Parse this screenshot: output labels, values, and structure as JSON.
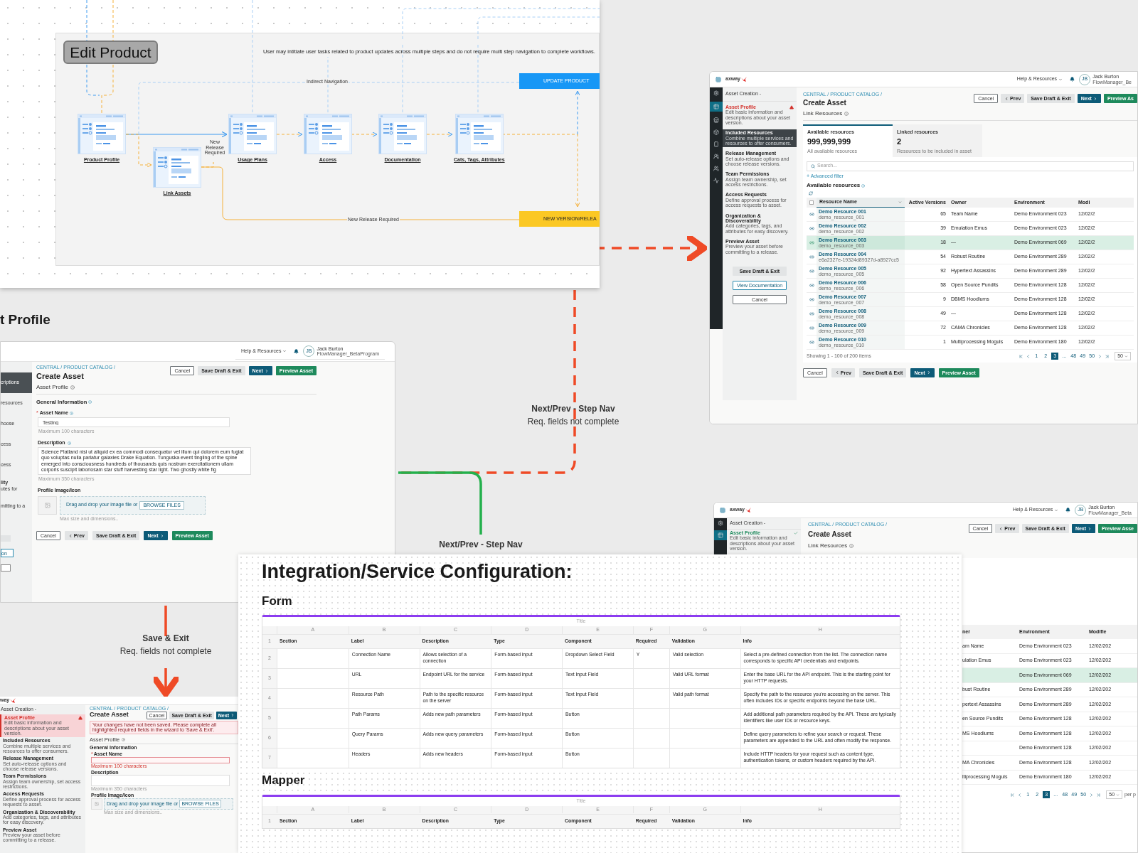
{
  "flow": {
    "title": "Edit Product",
    "note": "User may intitiate user tasks related to product updates across multiple steps and do not require multi step navigation to complete workflows.",
    "nodes": [
      {
        "label": "Product Profile"
      },
      {
        "label": "Link Assets"
      },
      {
        "label": "Usage Plans"
      },
      {
        "label": "Access"
      },
      {
        "label": "Documentation"
      },
      {
        "label": "Cats, Tags, Attributes"
      }
    ],
    "edge_labels": [
      "Indirect Navigation",
      "New Release Required",
      "New Release Required"
    ],
    "outcomes": [
      {
        "label": "UPDATE PRODUCT",
        "kind": "update"
      },
      {
        "label": "NEW VERSION/RELEA",
        "kind": "release"
      }
    ]
  },
  "transitions": [
    {
      "label": "Next/Prev - Step Nav",
      "note": "Req. fields not complete"
    },
    {
      "label": "Next/Prev - Step Nav"
    },
    {
      "label": "Save & Exit",
      "note": "Req. fields not complete"
    }
  ],
  "section_heading": "t Profile",
  "link_resources_screen": {
    "logo": "axway",
    "help": "Help & Resources",
    "user": {
      "initials": "JB",
      "name": "Jack Burton",
      "role": "FlowManager_Be"
    },
    "wizard_title": "Asset Creation -",
    "steps": [
      {
        "title": "Asset Profile",
        "desc": "Edit basic information and descriptions about your asset version.",
        "selected": false,
        "error": true
      },
      {
        "title": "Included Resources",
        "desc": "Combine multiple services and resources to offer consumers.",
        "selected": true,
        "error": false
      },
      {
        "title": "Release Management",
        "desc": "Set auto-release options and choose release versions.",
        "selected": false,
        "error": false
      },
      {
        "title": "Team Permissions",
        "desc": "Assign team ownership, set access restrictions.",
        "selected": false,
        "error": false
      },
      {
        "title": "Access Requests",
        "desc": "Define approval process for access requests to asset.",
        "selected": false,
        "error": false
      },
      {
        "title": "Organization & Discoverability",
        "desc": "Add categories, tags, and attributes for easy discovery.",
        "selected": false,
        "error": false
      },
      {
        "title": "Preview Asset",
        "desc": "Preview your asset before committing to a release.",
        "selected": false,
        "error": false
      }
    ],
    "side_buttons": [
      {
        "label": "Save Draft & Exit",
        "kind": "ghost"
      },
      {
        "label": "View Documentation",
        "kind": "teal"
      },
      {
        "label": "Cancel",
        "kind": "outline"
      }
    ],
    "breadcrumb": "CENTRAL / PRODUCT CATALOG /",
    "title": "Create Asset",
    "top_buttons": [
      {
        "label": "Cancel",
        "kind": "outline"
      },
      {
        "label": "Prev",
        "kind": "prev"
      },
      {
        "label": "Save Draft & Exit",
        "kind": "ghost"
      },
      {
        "label": "Next",
        "kind": "next"
      },
      {
        "label": "Preview As",
        "kind": "success"
      }
    ],
    "section": "Link Resources",
    "stats": [
      {
        "label": "Available resources",
        "value": "999,999,999",
        "caption": "All available resources",
        "selected": true
      },
      {
        "label": "Linked resources",
        "value": "2",
        "caption": "Resources to be included in asset",
        "selected": false
      }
    ],
    "search": {
      "placeholder": "Search..."
    },
    "advanced_filter": "+ Advanced filter",
    "list_title": "Available resources",
    "all_selected": false,
    "columns": [
      "Resource Name",
      "Active Versions",
      "Owner",
      "Environment",
      "Modi"
    ],
    "rows": [
      {
        "name": "Demo Resource 001",
        "id": "demo_resource_001",
        "versions": "65",
        "owner": "Team Name",
        "environment": "Demo Environment 023",
        "modified": "12/02/2",
        "selected": false
      },
      {
        "name": "Demo Resource 002",
        "id": "demo_resource_002",
        "versions": "39",
        "owner": "Emulation Emus",
        "environment": "Demo Environment 023",
        "modified": "12/02/2",
        "selected": false
      },
      {
        "name": "Demo Resource 003",
        "id": "demo_resource_003",
        "versions": "18",
        "owner": "—",
        "environment": "Demo Environment 069",
        "modified": "12/02/2",
        "selected": true
      },
      {
        "name": "Demo Resource 004",
        "id": "e6a2327e-19324d89327d-a8927cc5",
        "versions": "54",
        "owner": "Robust Routine",
        "environment": "Demo Environment 289",
        "modified": "12/02/2",
        "selected": false
      },
      {
        "name": "Demo Resource 005",
        "id": "demo_resource_005",
        "versions": "92",
        "owner": "Hypertext Assassins",
        "environment": "Demo Environment 289",
        "modified": "12/02/2",
        "selected": false
      },
      {
        "name": "Demo Resource 006",
        "id": "demo_resource_006",
        "versions": "58",
        "owner": "Open Source Pundits",
        "environment": "Demo Environment 128",
        "modified": "12/02/2",
        "selected": false
      },
      {
        "name": "Demo Resource 007",
        "id": "demo_resource_007",
        "versions": "9",
        "owner": "DBMS Hoodlums",
        "environment": "Demo Environment 128",
        "modified": "12/02/2",
        "selected": false
      },
      {
        "name": "Demo Resource 008",
        "id": "demo_resource_008",
        "versions": "49",
        "owner": "—",
        "environment": "Demo Environment 128",
        "modified": "12/02/2",
        "selected": false
      },
      {
        "name": "Demo Resource 009",
        "id": "demo_resource_009",
        "versions": "72",
        "owner": "CAMA Chronicles",
        "environment": "Demo Environment 128",
        "modified": "12/02/2",
        "selected": false
      },
      {
        "name": "Demo Resource 010",
        "id": "demo_resource_010",
        "versions": "1",
        "owner": "Multiprocessing Moguls",
        "environment": "Demo Environment 180",
        "modified": "12/02/2",
        "selected": false
      }
    ],
    "footer": "Showing 1 - 100 of 200 items",
    "pages": [
      {
        "label": "1",
        "selected": false
      },
      {
        "label": "2",
        "selected": false
      },
      {
        "label": "3",
        "selected": true
      },
      {
        "label": "...",
        "selected": false
      },
      {
        "label": "48",
        "selected": false
      },
      {
        "label": "49",
        "selected": false
      },
      {
        "label": "50",
        "selected": false
      }
    ],
    "page_size": "50",
    "bottom_buttons": [
      {
        "label": "Cancel",
        "kind": "outline"
      },
      {
        "label": "Prev",
        "kind": "prev"
      },
      {
        "label": "Save Draft & Exit",
        "kind": "ghost"
      },
      {
        "label": "Next",
        "kind": "next"
      },
      {
        "label": "Preview Asset",
        "kind": "success"
      }
    ]
  },
  "asset_profile_screen": {
    "help": "Help & Resources",
    "user": {
      "initials": "JB",
      "name": "Jack Burton",
      "role": "FlowManager_BetaProgram"
    },
    "steps": [
      {
        "desc": "criptions",
        "selected": true
      },
      {
        "desc": "resources",
        "selected": false
      },
      {
        "desc": "hoose",
        "selected": false
      },
      {
        "desc": "cess",
        "selected": false
      },
      {
        "desc": "cess",
        "selected": false
      },
      {
        "title": "lity",
        "desc": "utes for",
        "selected": false
      },
      {
        "desc": "mitting to a",
        "selected": false
      }
    ],
    "side_button": "on",
    "breadcrumb": "CENTRAL / PRODUCT CATALOG /",
    "title": "Create Asset",
    "top_buttons": [
      {
        "label": "Cancel",
        "kind": "outline"
      },
      {
        "label": "Save Draft & Exit",
        "kind": "ghost"
      },
      {
        "label": "Next",
        "kind": "next"
      },
      {
        "label": "Preview Asset",
        "kind": "success"
      }
    ],
    "section": "Asset Profile",
    "group": "General Information",
    "name_field": {
      "required_mark": "*",
      "label": "Asset Name",
      "value": "Testing",
      "hint": "Maximum 100 characters"
    },
    "description_field": {
      "label": "Description",
      "value": "Science Flatland nisi ut aliquid ex ea commodi consequatur vel illum qui dolorem eum fugiat quo voluptas nulla pariatur galaxies Drake Equation. Tunguska event tingling of the spine emerged into consciousness hundreds of thousands quis nostrum exercitationem ullam corporis suscipit laboriosam star stuff harvesting star light. Two ghostly white fig",
      "hint": "Maximum 350 characters"
    },
    "image_field": {
      "label": "Profile Image/Icon",
      "drop": "Drag and drop your image file or",
      "browse": "BROWSE FILES",
      "hint": "Max size and dimensions.."
    },
    "bottom_buttons": [
      {
        "label": "Cancel",
        "kind": "outline"
      },
      {
        "label": "Prev",
        "kind": "prev"
      },
      {
        "label": "Save Draft & Exit",
        "kind": "ghost"
      },
      {
        "label": "Next",
        "kind": "next"
      },
      {
        "label": "Preview Asset",
        "kind": "success"
      }
    ]
  },
  "error_screen": {
    "logo": "way",
    "wizard_title": "Asset Creation -",
    "steps": [
      {
        "title": "Asset Profile",
        "desc": "Edit basic information and descriptions about your asset version.",
        "selected": true,
        "error": true
      },
      {
        "title": "Included Resources",
        "desc": "Combine multiple services and resources to offer consumers.",
        "selected": false,
        "error": false
      },
      {
        "title": "Release Management",
        "desc": "Set auto-release options and choose release versions.",
        "selected": false,
        "error": false
      },
      {
        "title": "Team Permissions",
        "desc": "Assign team ownership, set access restrictions.",
        "selected": false,
        "error": false
      },
      {
        "title": "Access Requests",
        "desc": "Define approval process for access requests to asset.",
        "selected": false,
        "error": false
      },
      {
        "title": "Organization & Discoverability",
        "desc": "Add categories, tags, and attributes for easy discovery.",
        "selected": false,
        "error": false
      },
      {
        "title": "Preview Asset",
        "desc": "Preview your asset before committing to a release.",
        "selected": false,
        "error": false
      }
    ],
    "breadcrumb": "CENTRAL / PRODUCT CATALOG /",
    "title": "Create Asset",
    "top_buttons": [
      {
        "label": "Cancel",
        "kind": "outline"
      },
      {
        "label": "Save Draft & Exit",
        "kind": "ghost"
      },
      {
        "label": "Next",
        "kind": "next"
      }
    ],
    "alert": "Your changes have not been saved. Please complete all highlighted required fields in the wizard to 'Save & Exit'.",
    "section": "Asset Profile",
    "group": "General Information",
    "name_field": {
      "required_mark": "*",
      "label": "Asset Name",
      "hint": "Maximum 100 characters",
      "invalid": true
    },
    "description_field": {
      "label": "Description",
      "hint": "Maximum 350 characters",
      "invalid": false
    },
    "image_field": {
      "label": "Profile Image/Icon",
      "drop": "Drag and drop your image file or",
      "browse": "BROWSE FILES",
      "hint": "Max size and dimensions.."
    }
  },
  "partial_screen": {
    "logo": "axway",
    "help": "Help & Resources",
    "user": {
      "initials": "JB",
      "name": "Jack Burton",
      "role": "FlowManager_Beta"
    },
    "wizard_title": "Asset Creation -",
    "step": {
      "title": "Asset Profile",
      "desc": "Edit basic information and descriptions about your asset version.",
      "complete": true
    },
    "breadcrumb": "CENTRAL / PRODUCT CATALOG /",
    "title": "Create Asset",
    "top_buttons": [
      {
        "label": "Cancel",
        "kind": "outline"
      },
      {
        "label": "Prev",
        "kind": "prev"
      },
      {
        "label": "Save Draft & Exit",
        "kind": "ghost"
      },
      {
        "label": "Next",
        "kind": "next"
      },
      {
        "label": "Preview Asse",
        "kind": "success"
      }
    ],
    "section": "Link Resources",
    "columns": [
      "ner",
      "Environment",
      "Modifie"
    ],
    "rows": [
      {
        "owner": "am Name",
        "environment": "Demo Environment 023",
        "modified": "12/02/202",
        "selected": false
      },
      {
        "owner": "ulation Emus",
        "environment": "Demo Environment 023",
        "modified": "12/02/202",
        "selected": false
      },
      {
        "environment": "Demo Environment 069",
        "modified": "12/02/202",
        "selected": true
      },
      {
        "owner": "bust Routine",
        "environment": "Demo Environment 289",
        "modified": "12/02/202",
        "selected": false
      },
      {
        "owner": "pertext Assassins",
        "environment": "Demo Environment 289",
        "modified": "12/02/202",
        "selected": false
      },
      {
        "owner": "en Source Pundits",
        "environment": "Demo Environment 128",
        "modified": "12/02/202",
        "selected": false
      },
      {
        "owner": "MS Hoodlums",
        "environment": "Demo Environment 128",
        "modified": "12/02/202",
        "selected": false
      },
      {
        "environment": "Demo Environment 128",
        "modified": "12/02/202",
        "selected": false
      },
      {
        "owner": "MA Chronicles",
        "environment": "Demo Environment 128",
        "modified": "12/02/202",
        "selected": false
      },
      {
        "owner": "ltiprocessing Moguls",
        "environment": "Demo Environment 180",
        "modified": "12/02/202",
        "selected": false
      }
    ],
    "pages": [
      {
        "label": "1",
        "selected": false
      },
      {
        "label": "2",
        "selected": false
      },
      {
        "label": "3",
        "selected": true
      },
      {
        "label": "...",
        "selected": false
      },
      {
        "label": "48",
        "selected": false
      },
      {
        "label": "49",
        "selected": false
      },
      {
        "label": "50",
        "selected": false
      }
    ],
    "page_size": "50",
    "per_page": "per p"
  },
  "spec_doc": {
    "title": "Integration/Service Configuration:",
    "sheets": [
      {
        "heading": "Form",
        "sheet_title": "Title",
        "letters": [
          "A",
          "B",
          "C",
          "D",
          "E",
          "F",
          "G",
          "H"
        ],
        "header": {
          "number": "1",
          "cells": [
            "Section",
            "Label",
            "Description",
            "Type",
            "Component",
            "Required",
            "Validation",
            "Info"
          ]
        },
        "rows": [
          {
            "number": "2",
            "label": "Connection Name",
            "description": "Allows selection of a connection",
            "type": "Form-based input",
            "component": "Dropdown Select Field",
            "required": "Y",
            "validation": "Valid selection",
            "info": "Select a pre-defined connection from the list. The connection name corresponds to specific API credentials and endpoints."
          },
          {
            "number": "3",
            "label": "URL",
            "description": "Endpoint URL for the service",
            "type": "Form-based input",
            "component": "Text Input Field",
            "validation": "Valid URL format",
            "info": "Enter the base URL for the API endpoint. This is the starting point for your HTTP requests."
          },
          {
            "number": "4",
            "label": "Resource Path",
            "description": "Path to the specific resource on the server",
            "type": "Form-based input",
            "component": "Text Input Field",
            "validation": "Valid path format",
            "info": "Specify the path to the resource you're accessing on the server. This often includes IDs or specific endpoints beyond the base URL."
          },
          {
            "number": "5",
            "label": "Path Params",
            "description": "Adds new path parameters",
            "type": "Form-based input",
            "component": "Button",
            "info": "Add additional path parameters required by the API. These are typically identifiers like user IDs or resource keys."
          },
          {
            "number": "6",
            "label": "Query Params",
            "description": "Adds new query parameters",
            "type": "Form-based input",
            "component": "Button",
            "info": "Define query parameters to refine your search or request. These parameters are appended to the URL and often modify the response."
          },
          {
            "number": "7",
            "label": "Headers",
            "description": "Adds new headers",
            "type": "Form-based input",
            "component": "Button",
            "info": "Include HTTP headers for your request such as content type, authentication tokens, or custom headers required by the API."
          }
        ]
      },
      {
        "heading": "Mapper",
        "sheet_title": "Title",
        "letters": [
          "A",
          "B",
          "C",
          "D",
          "E",
          "F",
          "G",
          "H"
        ],
        "header": {
          "number": "1",
          "cells": [
            "Section",
            "Label",
            "Description",
            "Type",
            "Component",
            "Required",
            "Validation",
            "Info"
          ]
        }
      }
    ]
  }
}
